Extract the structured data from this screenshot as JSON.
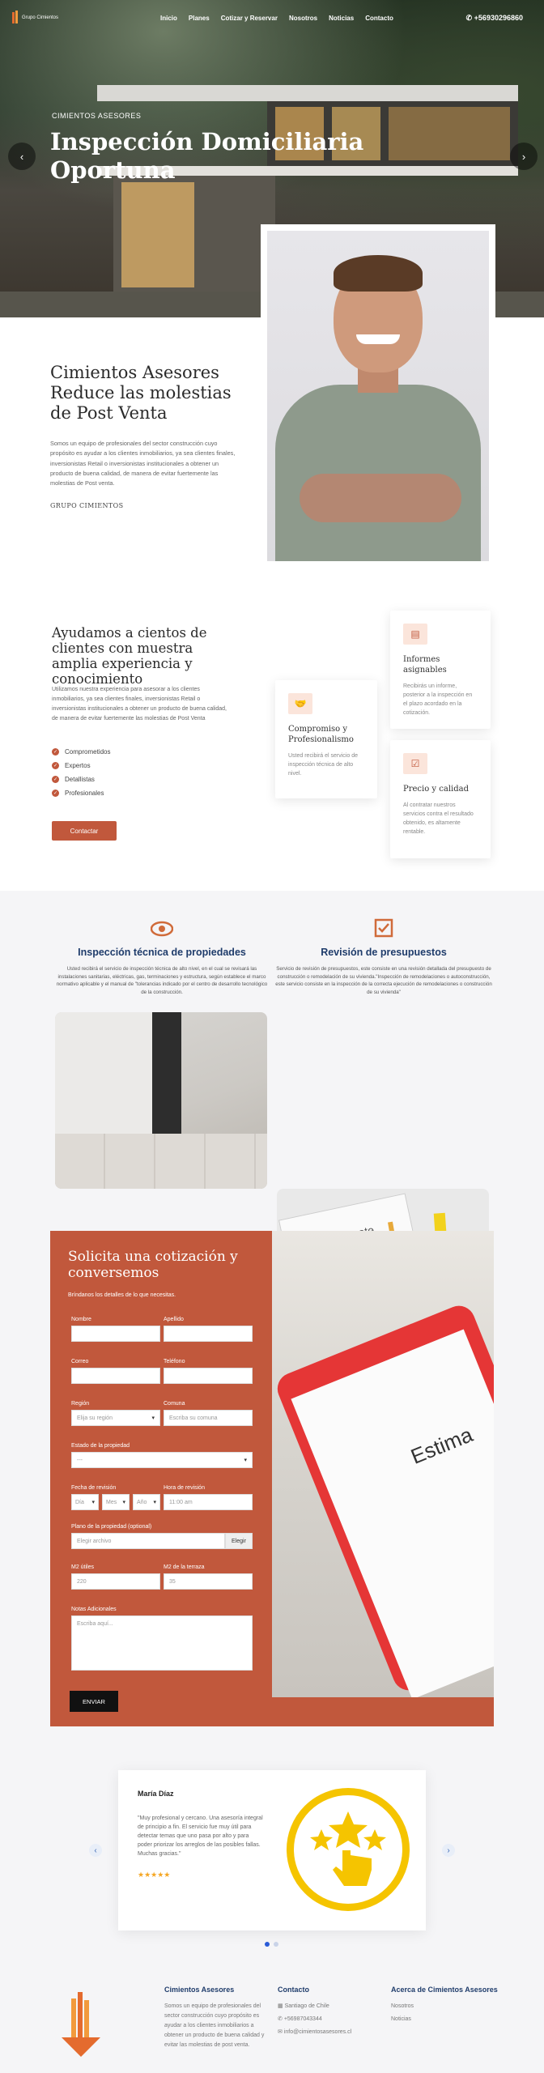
{
  "nav": {
    "logo_text": "Grupo Cimientos",
    "links": [
      "Inicio",
      "Planes",
      "Cotizar y Reservar",
      "Nosotros",
      "Noticias",
      "Contacto"
    ],
    "phone": "+56930296860"
  },
  "hero": {
    "eyebrow": "CIMIENTOS ASESORES",
    "title": "Inspección Domiciliaria Oportuna",
    "prev_icon": "chevron-left-icon",
    "next_icon": "chevron-right-icon"
  },
  "about": {
    "title": "Cimientos Asesores Reduce las molestias de Post Venta",
    "text": "Somos un equipo de profesionales del sector construcción cuyo propósito es ayudar a los clientes inmobiliarios, ya sea clientes finales, inversionistas Retail o inversionistas institucionales a obtener un producto de buena calidad, de manera de evitar fuertemente las molestias de Post venta.",
    "signature": "GRUPO CIMIENTOS"
  },
  "help": {
    "title": "Ayudamos a cientos de clientes con muestra amplia experiencia y conocimiento",
    "text": "Utilizamos nuestra experiencia para asesorar a los clientes inmobiliarios, ya sea clientes finales, inversionistas Retail o inversionistas institucionales a obtener un producto de buena calidad, de manera de evitar fuertemente las molestias de Post Venta",
    "checks": [
      "Comprometidos",
      "Expertos",
      "Detallistas",
      "Profesionales"
    ],
    "button": "Contactar",
    "cards": [
      {
        "icon": "document-icon",
        "title": "Informes asignables",
        "text": "Recibirás un informe, posterior a la inspección en el plazo acordado en la cotización."
      },
      {
        "icon": "handshake-icon",
        "title": "Compromiso y Profesionalismo",
        "text": "Usted recibirá el servicio de inspección técnica de alto nivel."
      },
      {
        "icon": "checkbox-icon",
        "title": "Precio y calidad",
        "text": "Al contratar nuestros servicios contra el resultado obtenido, es altamente rentable."
      }
    ]
  },
  "services": [
    {
      "icon": "eye-icon",
      "title": "Inspección técnica de propiedades",
      "text": "Usted recibirá el servicio de inspección técnica de alto nivel, en el cual se revisará las instalaciones sanitarias, eléctricas, gas, terminaciones y estructura, según establece el marco normativo aplicable y el manual de \"tolerancias indicado por el centro de desarrollo tecnológico de la construcción."
    },
    {
      "icon": "checkbox-icon",
      "title": "Revisión de presupuestos",
      "text": "Servicio de revisión de presupuestos, este consiste en una revisión detallada del presupuesto de construcción o remodelación de su vivienda.\"Inspección de remodelaciones o autoconstrucción, este servicio consiste en la inspección de la correcta ejecución de remodelaciones o construcción de su vivienda\""
    }
  ],
  "form": {
    "title": "Solicita una cotización y conversemos",
    "subtitle": "Bríndanos los detalles de lo que necesitas.",
    "fields": {
      "nombre": "Nombre",
      "apellido": "Apellido",
      "correo": "Correo",
      "telefono": "Teléfono",
      "region": "Región",
      "region_placeholder": "Elija su región",
      "comuna": "Comuna",
      "comuna_placeholder": "Escriba su comuna",
      "estado": "Estado de la propiedad",
      "estado_value": "---",
      "fecha": "Fecha de revisión",
      "dia": "Día",
      "mes": "Mes",
      "anio": "Año",
      "hora": "Hora de revisión",
      "hora_placeholder": "11:00 am",
      "plano": "Plano de la propiedad (optional)",
      "plano_placeholder": "Elegir archivo",
      "plano_button": "Elegir",
      "m2_utiles": "M2 útiles",
      "m2_utiles_placeholder": "220",
      "m2_terraza": "M2 de la terraza",
      "m2_terraza_placeholder": "35",
      "notas": "Notas Adicionales",
      "notas_placeholder": "Escriba aquí..."
    },
    "submit": "ENVIAR"
  },
  "testimonial": {
    "name": "María Díaz",
    "quote": "\"Muy profesional y cercano. Una asesoría integral de principio a fin. El servicio fue muy útil para detectar temas que uno pasa por alto y para poder priorizar los arreglos de las posibles fallas. Muchas gracias.\"",
    "stars": "★★★★★",
    "rating": 5,
    "prev_icon": "chevron-left-icon",
    "next_icon": "chevron-right-icon"
  },
  "footer": {
    "col1_title": "Cimientos Asesores",
    "col1_text": "Somos un equipo de profesionales del sector construcción cuyo propósito es ayudar a los clientes inmobiliarios a obtener un producto de buena calidad y evitar las molestias de post venta.",
    "col2_title": "Contacto",
    "address": "Santiago de Chile",
    "phone": "+56987043344",
    "email": "info@cimientosasesores.cl",
    "col3_title": "Acerca de Cimientos Asesores",
    "links": [
      "Nosotros",
      "Noticias"
    ]
  },
  "colors": {
    "accent": "#c1583c",
    "navy": "#1f3c6b",
    "star": "#f5c400"
  }
}
